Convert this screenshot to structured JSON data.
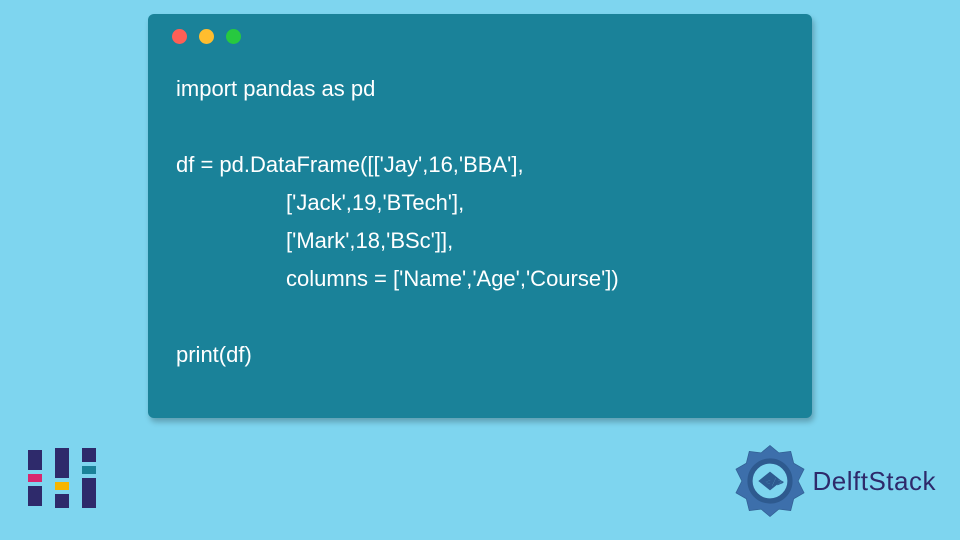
{
  "window": {
    "dots": [
      "red",
      "yellow",
      "green"
    ]
  },
  "code": {
    "line1": "import pandas as pd",
    "line2": "",
    "line3": "df = pd.DataFrame([['Jay',16,'BBA'],",
    "line4": "                  ['Jack',19,'BTech'],",
    "line5": "                  ['Mark',18,'BSc']],",
    "line6": "                  columns = ['Name','Age','Course'])",
    "line7": "",
    "line8": "print(df)"
  },
  "brand": {
    "name": "DelftStack"
  },
  "colors": {
    "page_bg": "#7ed5ef",
    "window_bg": "#1a8299",
    "brand_dark": "#2e2a6b",
    "code_text": "#ffffff"
  }
}
